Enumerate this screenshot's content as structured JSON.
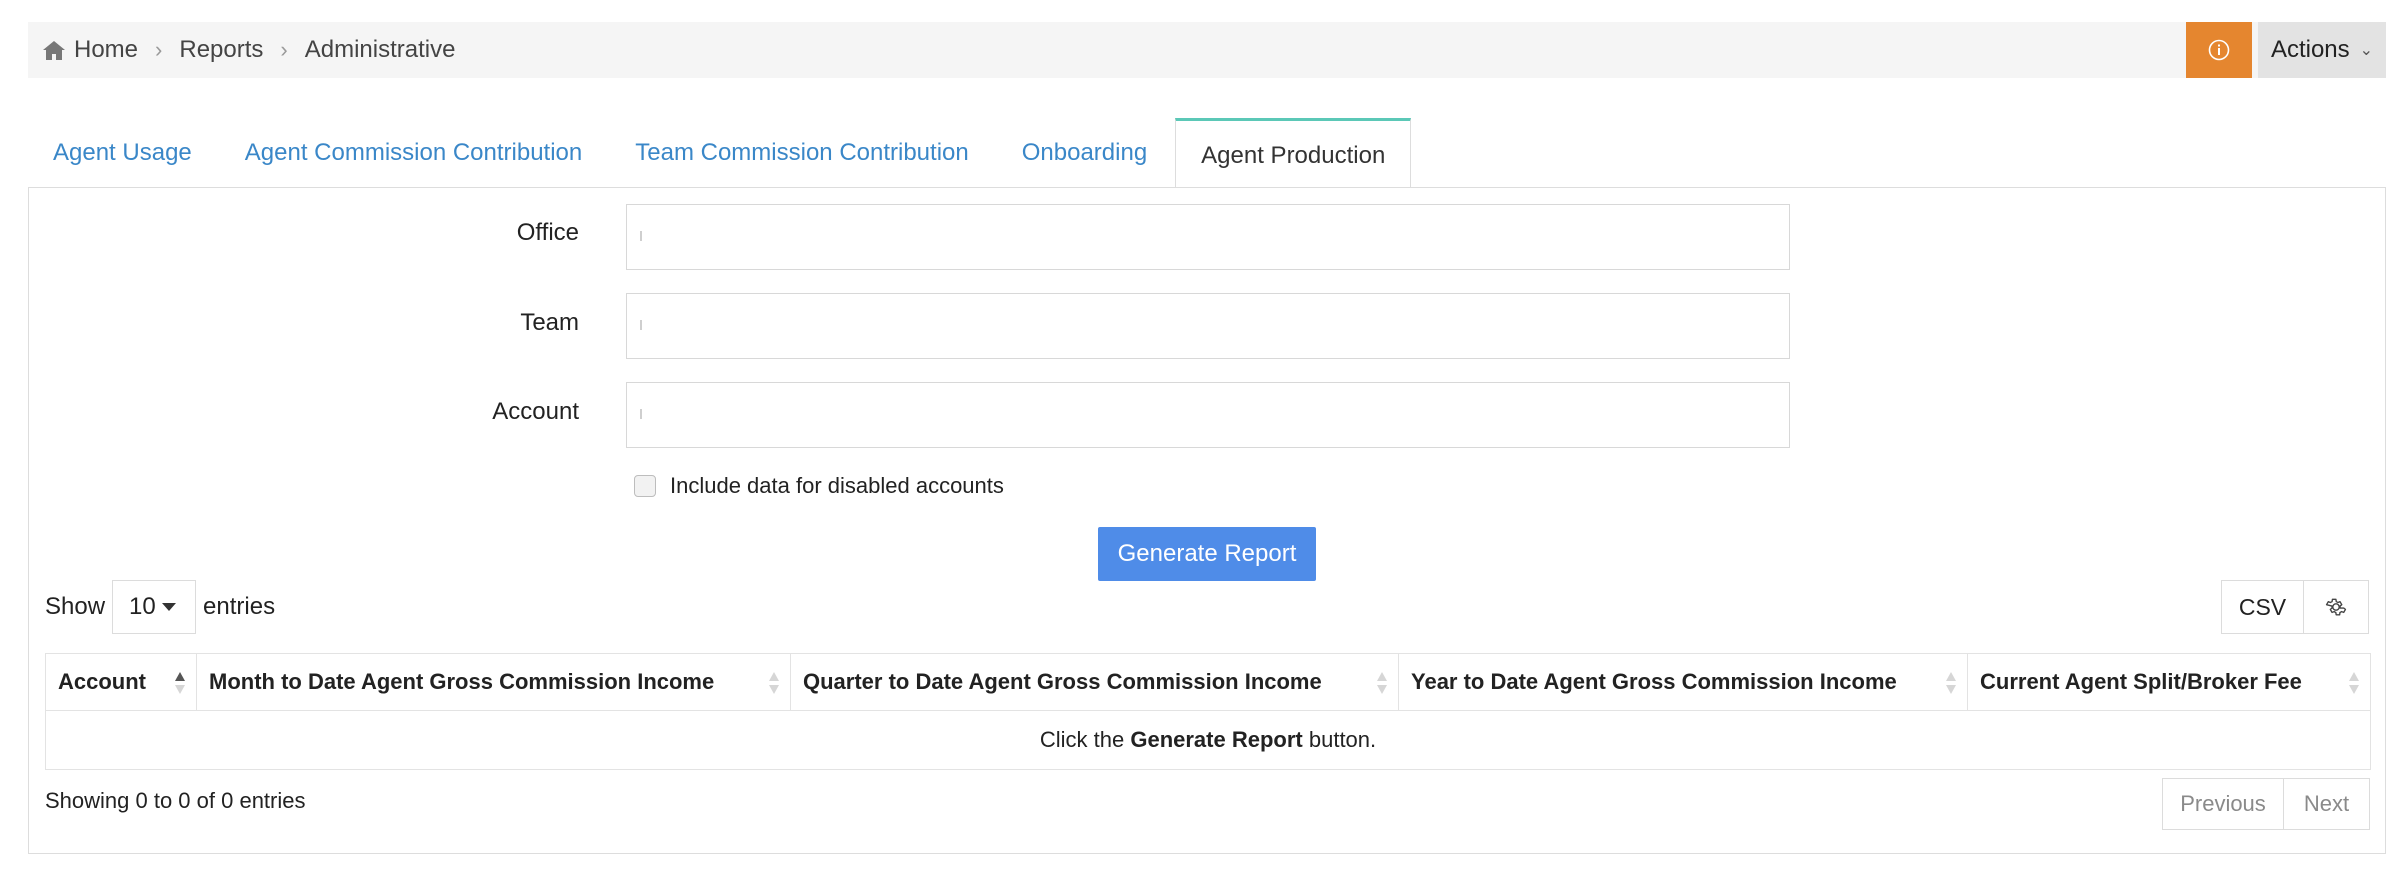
{
  "breadcrumb": {
    "home": "Home",
    "reports": "Reports",
    "current": "Administrative"
  },
  "header": {
    "actions_label": "Actions"
  },
  "tabs": [
    {
      "label": "Agent Usage"
    },
    {
      "label": "Agent Commission Contribution"
    },
    {
      "label": "Team Commission Contribution"
    },
    {
      "label": "Onboarding"
    },
    {
      "label": "Agent Production",
      "active": true
    }
  ],
  "form": {
    "office_label": "Office",
    "office_value": "",
    "team_label": "Team",
    "team_value": "",
    "account_label": "Account",
    "account_value": "",
    "include_disabled_label": "Include data for disabled accounts",
    "include_disabled_checked": false,
    "generate_label": "Generate Report"
  },
  "table_controls": {
    "show_label": "Show",
    "page_length": "10",
    "entries_label": "entries",
    "csv_label": "CSV"
  },
  "table": {
    "columns": [
      "Account",
      "Month to Date Agent Gross Commission Income",
      "Quarter to Date Agent Gross Commission Income",
      "Year to Date Agent Gross Commission Income",
      "Current Agent Split/Broker Fee"
    ],
    "sorted_column": "Account",
    "empty_prefix": "Click the",
    "empty_bold": "Generate Report",
    "empty_suffix": "button."
  },
  "footer": {
    "info": "Showing 0 to 0 of 0 entries",
    "previous": "Previous",
    "next": "Next"
  },
  "colors": {
    "accent_orange": "#e5862f",
    "primary_blue": "#4f8ce8",
    "tab_link": "#3a87c8",
    "active_tab_top": "#5bc8b7"
  }
}
